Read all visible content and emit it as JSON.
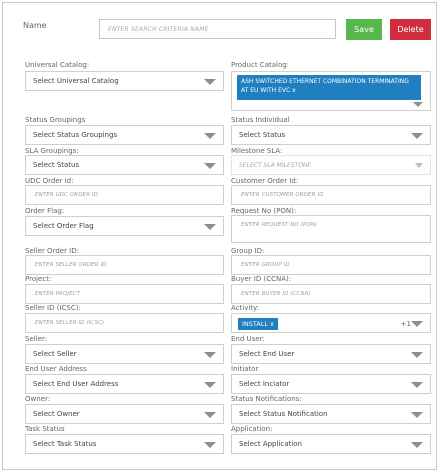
{
  "header": {
    "name_label": "Name",
    "name_placeholder": "ENTER SEARCH CRITERIA NAME",
    "save_label": "Save",
    "delete_label": "Delete"
  },
  "colors": {
    "save": "#58b74b",
    "delete": "#cf2d3b",
    "chip": "#1f7fc0"
  },
  "fields": {
    "universal_catalog": {
      "label": "Universal Catalog:",
      "value": "Select Universal Catalog"
    },
    "product_catalog": {
      "label": "Product Catalog:",
      "chip": "ASH SWITCHED ETHERNET COMBINATION TERMINATING AT EU WITH EVC x"
    },
    "status_groupings": {
      "label": "Status Groupings",
      "value": "Select Status Groupings"
    },
    "status_individual": {
      "label": "Status Individual",
      "value": "Select Status"
    },
    "sla_groupings": {
      "label": "SLA Groupings:",
      "value": "Select Status"
    },
    "milestone_sla": {
      "label": "Milestone SLA:",
      "value": "SELECT SLA MILESTONE"
    },
    "udc_order_id": {
      "label": "UDC Order Id:",
      "placeholder": "ENTER UDC ORDER ID"
    },
    "customer_order_id": {
      "label": "Customer Order Id:",
      "placeholder": "ENTER CUSTOMER ORDER ID"
    },
    "order_flag": {
      "label": "Order Flag:",
      "value": "Select Order Flag"
    },
    "request_no": {
      "label": "Request No (PON):",
      "placeholder": "ENTER REQUEST NO (PON)"
    },
    "seller_order_id": {
      "label": "Seller Order ID:",
      "placeholder": "ENTER SELLER ORDER ID"
    },
    "group_id": {
      "label": "Group ID:",
      "placeholder": "ENTER GROUP ID"
    },
    "project": {
      "label": "Project:",
      "placeholder": "ENTER PROJECT"
    },
    "buyer_id": {
      "label": "Buyer ID (CCNA):",
      "placeholder": "ENTER BUYER ID (CCNA)"
    },
    "seller_id": {
      "label": "Seller ID (ICSC):",
      "placeholder": "ENTER SELLER ID (ICSC)"
    },
    "activity": {
      "label": "Activity:",
      "chip": "INSTALL x",
      "extra": "+1"
    },
    "seller": {
      "label": "Seller:",
      "value": "Select Seller"
    },
    "end_user": {
      "label": "End User:",
      "value": "Select End User"
    },
    "end_user_address": {
      "label": "End User Address",
      "value": "Select End User Address"
    },
    "initiator": {
      "label": "Initiator",
      "value": "Select Inciator"
    },
    "owner": {
      "label": "Owner:",
      "value": "Select Owner"
    },
    "status_notifications": {
      "label": "Status Notifications:",
      "value": "Select Status Notification"
    },
    "task_status": {
      "label": "Task Status",
      "value": "Select Task Status"
    },
    "application": {
      "label": "Application:",
      "value": "Select Application"
    }
  }
}
